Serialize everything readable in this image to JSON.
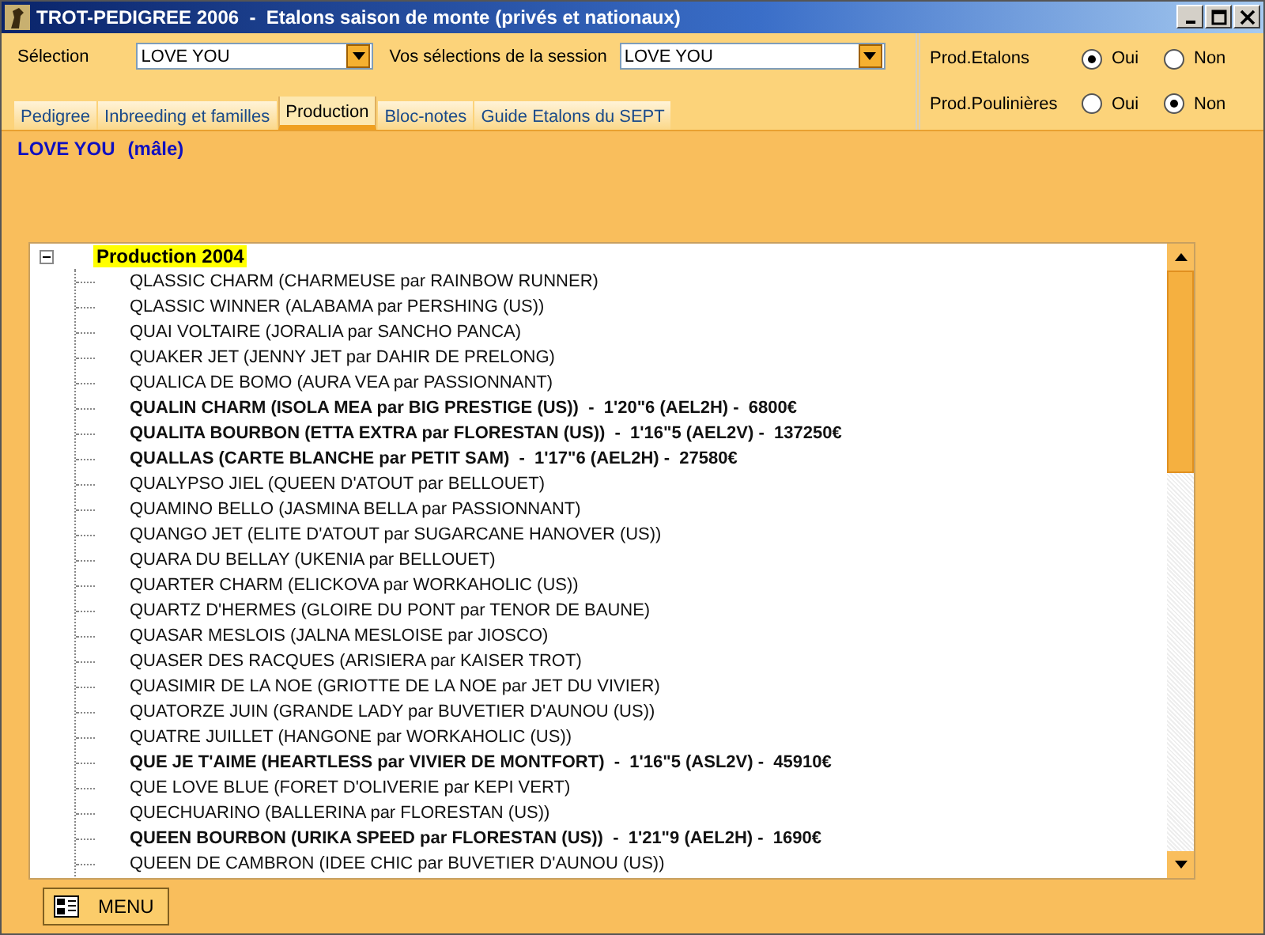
{
  "window": {
    "title": "TROT-PEDIGREE 2006  -  Etalons saison de monte (privés et nationaux)"
  },
  "selection": {
    "label": "Sélection",
    "value": "LOVE YOU"
  },
  "session": {
    "label": "Vos sélections de la session",
    "value": "LOVE YOU"
  },
  "options": [
    {
      "label": "Prod.Etalons",
      "choices": [
        {
          "label": "Oui",
          "selected": true
        },
        {
          "label": "Non",
          "selected": false
        }
      ]
    },
    {
      "label": "Prod.Poulinières",
      "choices": [
        {
          "label": "Oui",
          "selected": false
        },
        {
          "label": "Non",
          "selected": true
        }
      ]
    }
  ],
  "tabs": [
    {
      "label": "Pedigree",
      "selected": false
    },
    {
      "label": "Inbreeding et familles",
      "selected": false
    },
    {
      "label": "Production",
      "selected": true
    },
    {
      "label": "Bloc-notes",
      "selected": false
    },
    {
      "label": "Guide Etalons du SEPT",
      "selected": false
    }
  ],
  "horse": {
    "name": "LOVE YOU",
    "sex": "(mâle)"
  },
  "tree": {
    "label": "Production 2004",
    "expanded": true,
    "children": [
      {
        "label": "QLASSIC CHARM (CHARMEUSE par RAINBOW RUNNER)",
        "emphasized": false
      },
      {
        "label": "QLASSIC WINNER (ALABAMA par PERSHING (US))",
        "emphasized": false
      },
      {
        "label": "QUAI VOLTAIRE (JORALIA par SANCHO PANCA)",
        "emphasized": false
      },
      {
        "label": "QUAKER JET (JENNY JET par DAHIR DE PRELONG)",
        "emphasized": false
      },
      {
        "label": "QUALICA DE BOMO (AURA VEA par PASSIONNANT)",
        "emphasized": false
      },
      {
        "label": "QUALIN CHARM (ISOLA MEA par BIG PRESTIGE (US))  -  1'20\"6 (AEL2H) -  6800€",
        "emphasized": true
      },
      {
        "label": "QUALITA BOURBON (ETTA EXTRA par FLORESTAN (US))  -  1'16\"5 (AEL2V) -  137250€",
        "emphasized": true
      },
      {
        "label": "QUALLAS (CARTE BLANCHE par PETIT SAM)  -  1'17\"6 (AEL2H) -  27580€",
        "emphasized": true
      },
      {
        "label": "QUALYPSO JIEL (QUEEN D'ATOUT par BELLOUET)",
        "emphasized": false
      },
      {
        "label": "QUAMINO BELLO (JASMINA BELLA par PASSIONNANT)",
        "emphasized": false
      },
      {
        "label": "QUANGO JET (ELITE D'ATOUT par SUGARCANE HANOVER (US))",
        "emphasized": false
      },
      {
        "label": "QUARA DU BELLAY (UKENIA par BELLOUET)",
        "emphasized": false
      },
      {
        "label": "QUARTER CHARM (ELICKOVA par WORKAHOLIC (US))",
        "emphasized": false
      },
      {
        "label": "QUARTZ D'HERMES (GLOIRE DU PONT par TENOR DE BAUNE)",
        "emphasized": false
      },
      {
        "label": "QUASAR MESLOIS (JALNA MESLOISE par JIOSCO)",
        "emphasized": false
      },
      {
        "label": "QUASER DES RACQUES (ARISIERA par KAISER TROT)",
        "emphasized": false
      },
      {
        "label": "QUASIMIR DE LA NOE (GRIOTTE DE LA NOE par JET DU VIVIER)",
        "emphasized": false
      },
      {
        "label": "QUATORZE JUIN (GRANDE LADY par BUVETIER D'AUNOU (US))",
        "emphasized": false
      },
      {
        "label": "QUATRE JUILLET (HANGONE par WORKAHOLIC (US))",
        "emphasized": false
      },
      {
        "label": "QUE JE T'AIME (HEARTLESS par VIVIER DE MONTFORT)  -  1'16\"5 (ASL2V) -  45910€",
        "emphasized": true
      },
      {
        "label": "QUE LOVE BLUE (FORET D'OLIVERIE par KEPI VERT)",
        "emphasized": false
      },
      {
        "label": "QUECHUARINO (BALLERINA par FLORESTAN (US))",
        "emphasized": false
      },
      {
        "label": "QUEEN BOURBON (URIKA SPEED par FLORESTAN (US))  -  1'21\"9 (AEL2H) -  1690€",
        "emphasized": true
      },
      {
        "label": "QUEEN DE CAMBRON (IDEE CHIC par BUVETIER D'AUNOU (US))",
        "emphasized": false
      }
    ]
  },
  "menu_button": {
    "label": "MENU"
  }
}
